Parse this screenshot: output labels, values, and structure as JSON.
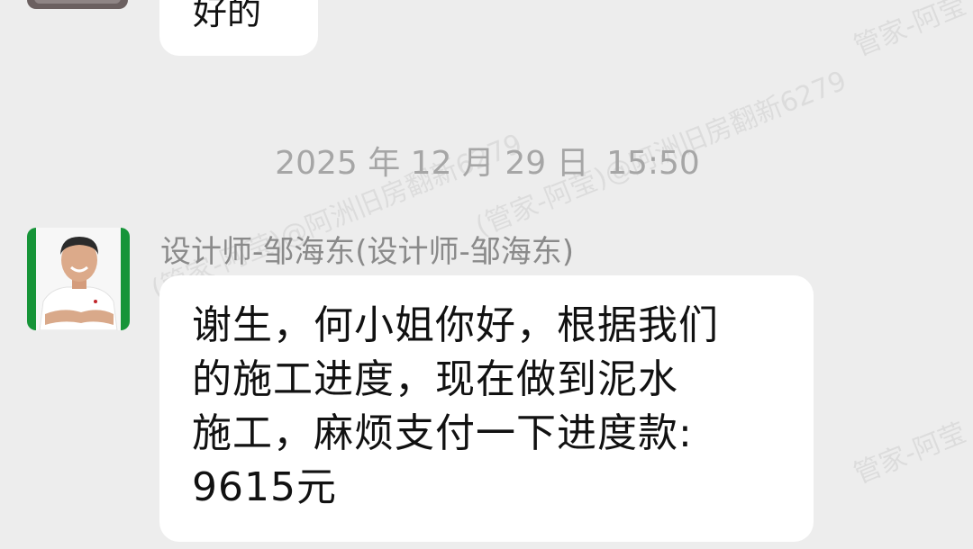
{
  "watermark": {
    "text_a": "管家-阿莹",
    "text_b": "(管家-阿莹)@阿洲旧房翻新6279"
  },
  "previous_message": {
    "text": "好的"
  },
  "timestamp": {
    "date": "2025 年 12 月 29 日",
    "time": "15:50"
  },
  "message": {
    "sender": "设计师-邹海东(设计师-邹海东)",
    "lines": [
      "谢生，何小姐你好，根据我们",
      "的施工进度，现在做到泥水",
      "施工，麻烦支付一下进度款:",
      "9615元"
    ]
  },
  "colors": {
    "background": "#ededed",
    "bubble": "#ffffff",
    "avatar_border": "#169438",
    "timestamp_text": "#a6a6a6",
    "sender_text": "#8a8a8a"
  }
}
